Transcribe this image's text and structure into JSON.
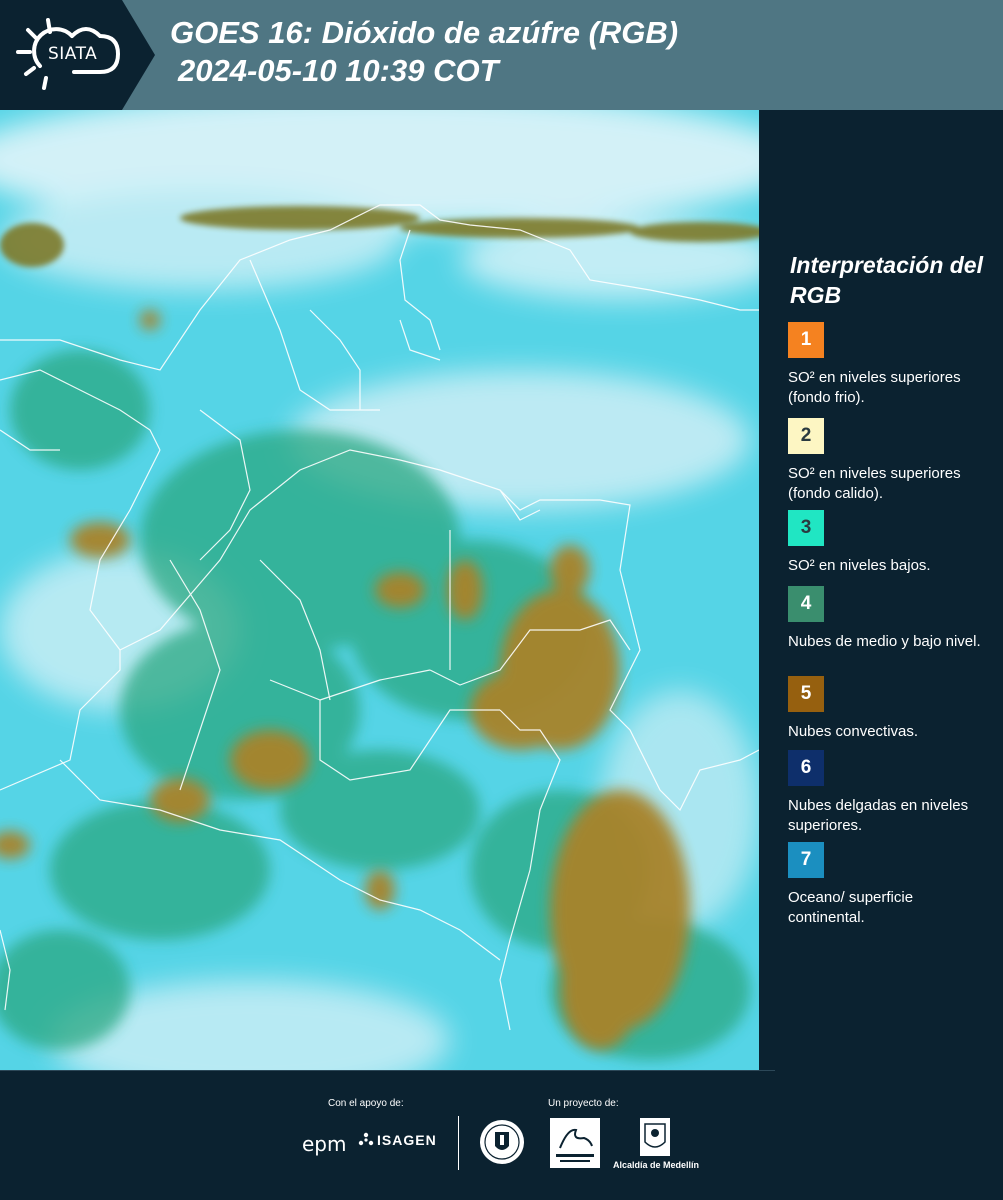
{
  "header": {
    "logo_text": "SIATA",
    "title_line1": "GOES 16: Dióxido de azúfre (RGB)",
    "title_line2": "2024-05-10 10:39 COT"
  },
  "legend": {
    "title": "Interpretación del RGB",
    "items": [
      {
        "number": "1",
        "color": "#f58220",
        "label": "SO² en niveles superiores (fondo frio)."
      },
      {
        "number": "2",
        "color": "#fdf6c3",
        "label": "SO² en niveles superiores (fondo calido)."
      },
      {
        "number": "3",
        "color": "#20e6c3",
        "label": "SO² en niveles bajos."
      },
      {
        "number": "4",
        "color": "#3a8e6e",
        "label": "Nubes de medio y bajo nivel."
      },
      {
        "number": "5",
        "color": "#96600f",
        "label": "Nubes convectivas."
      },
      {
        "number": "6",
        "color": "#0e2f6b",
        "label": "Nubes delgadas en niveles superiores."
      },
      {
        "number": "7",
        "color": "#1b8fc0",
        "label": "Oceano/ superficie continental."
      }
    ]
  },
  "footer": {
    "support_label": "Con el apoyo de:",
    "project_label": "Un proyecto de:",
    "epm": "epm",
    "isagen": "ISAGEN",
    "alcaldia": "Alcaldía de Medellín"
  }
}
